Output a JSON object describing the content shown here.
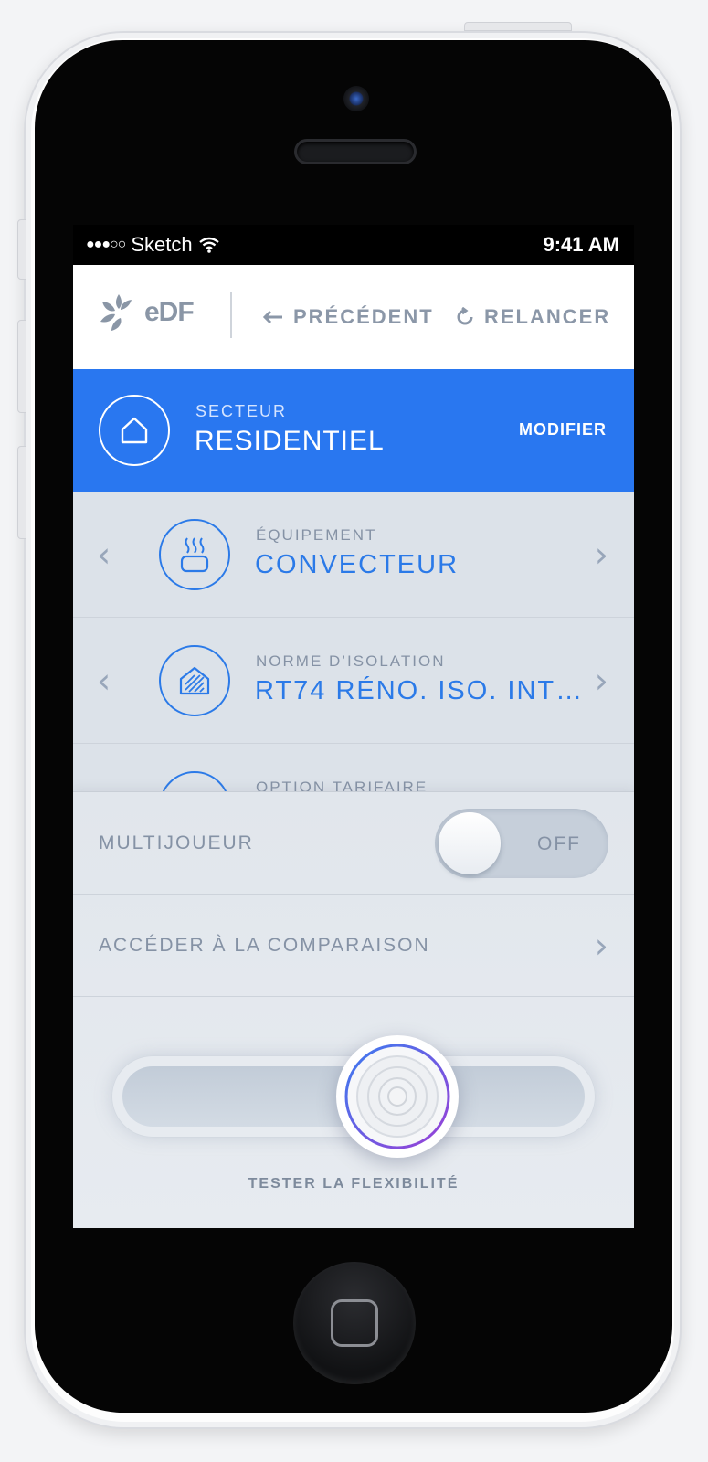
{
  "status_bar": {
    "signal": "●●●○○",
    "carrier": "Sketch",
    "time": "9:41 AM"
  },
  "header": {
    "logo_text": "eDF",
    "prev_label": "PRÉCÉDENT",
    "relaunch_label": "RELANCER"
  },
  "sector": {
    "label": "SECTEUR",
    "value": "RESIDENTIEL",
    "modify_label": "MODIFIER",
    "icon": "home-icon"
  },
  "rows": [
    {
      "label": "ÉQUIPEMENT",
      "value": "CONVECTEUR",
      "icon": "heater-icon"
    },
    {
      "label": "NORME D’ISOLATION",
      "value": "RT74 RÉNO. ISO. INT…",
      "icon": "insulated-house-icon"
    },
    {
      "label": "OPTION TARIFAIRE",
      "icon": "tariff-icon"
    }
  ],
  "panel": {
    "multiplayer_label": "MULTIJOUEUR",
    "toggle_state": "OFF",
    "compare_label": "ACCÉDER À LA COMPARAISON",
    "slider_caption": "TESTER LA FLEXIBILITÉ",
    "slider_value": 0.5
  },
  "colors": {
    "accent": "#2977f0",
    "link_blue": "#2b7ae8",
    "muted_text": "#8592a5"
  }
}
